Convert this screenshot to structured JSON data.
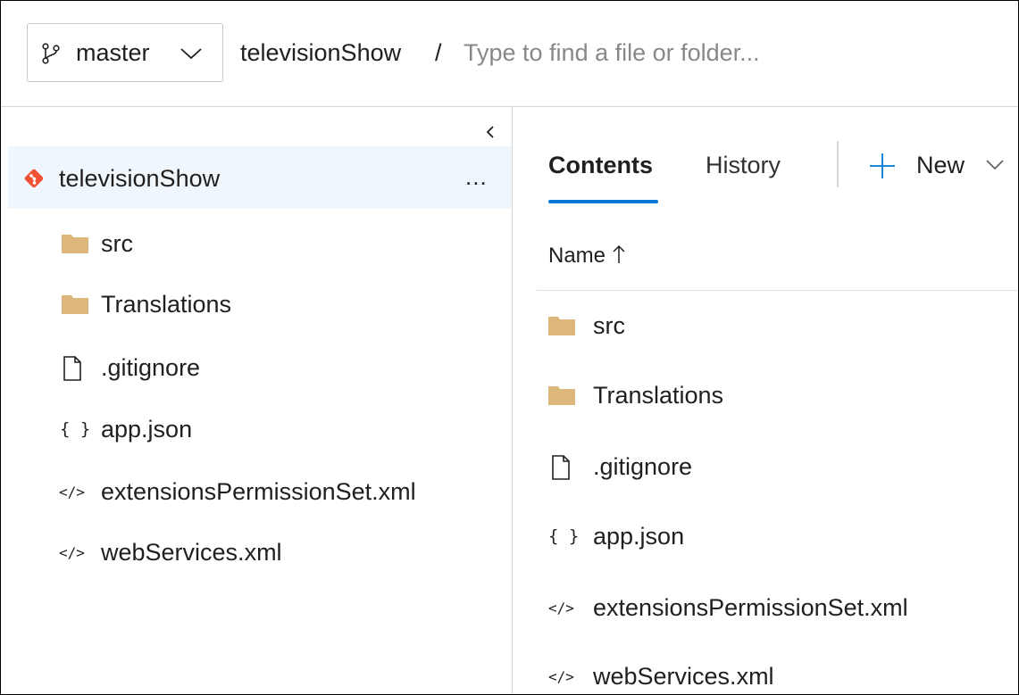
{
  "branch": {
    "name": "master",
    "icon": "branch-icon"
  },
  "repo": {
    "name": "televisionShow",
    "separator": "/"
  },
  "search": {
    "placeholder": "Type to find a file or folder..."
  },
  "sidebar": {
    "root": {
      "label": "televisionShow",
      "more": "..."
    },
    "items": [
      {
        "label": "src",
        "type": "folder"
      },
      {
        "label": "Translations",
        "type": "folder"
      },
      {
        "label": ".gitignore",
        "type": "file"
      },
      {
        "label": "app.json",
        "type": "json",
        "glyph": "{ }"
      },
      {
        "label": "extensionsPermissionSet.xml",
        "type": "xml",
        "glyph": "</>"
      },
      {
        "label": "webServices.xml",
        "type": "xml",
        "glyph": "</>"
      }
    ]
  },
  "main": {
    "tabs": [
      {
        "label": "Contents",
        "selected": true
      },
      {
        "label": "History",
        "selected": false
      }
    ],
    "new_label": "New",
    "column_header": "Name",
    "sort_direction": "ascending",
    "rows": [
      {
        "label": "src",
        "type": "folder"
      },
      {
        "label": "Translations",
        "type": "folder"
      },
      {
        "label": ".gitignore",
        "type": "file"
      },
      {
        "label": "app.json",
        "type": "json",
        "glyph": "{ }"
      },
      {
        "label": "extensionsPermissionSet.xml",
        "type": "xml",
        "glyph": "</>"
      },
      {
        "label": "webServices.xml",
        "type": "xml",
        "glyph": "</>"
      }
    ]
  },
  "colors": {
    "accent": "#0078d4",
    "folder": "#dcb67a",
    "git": "#f05133",
    "selected_bg": "#eff6fc"
  }
}
